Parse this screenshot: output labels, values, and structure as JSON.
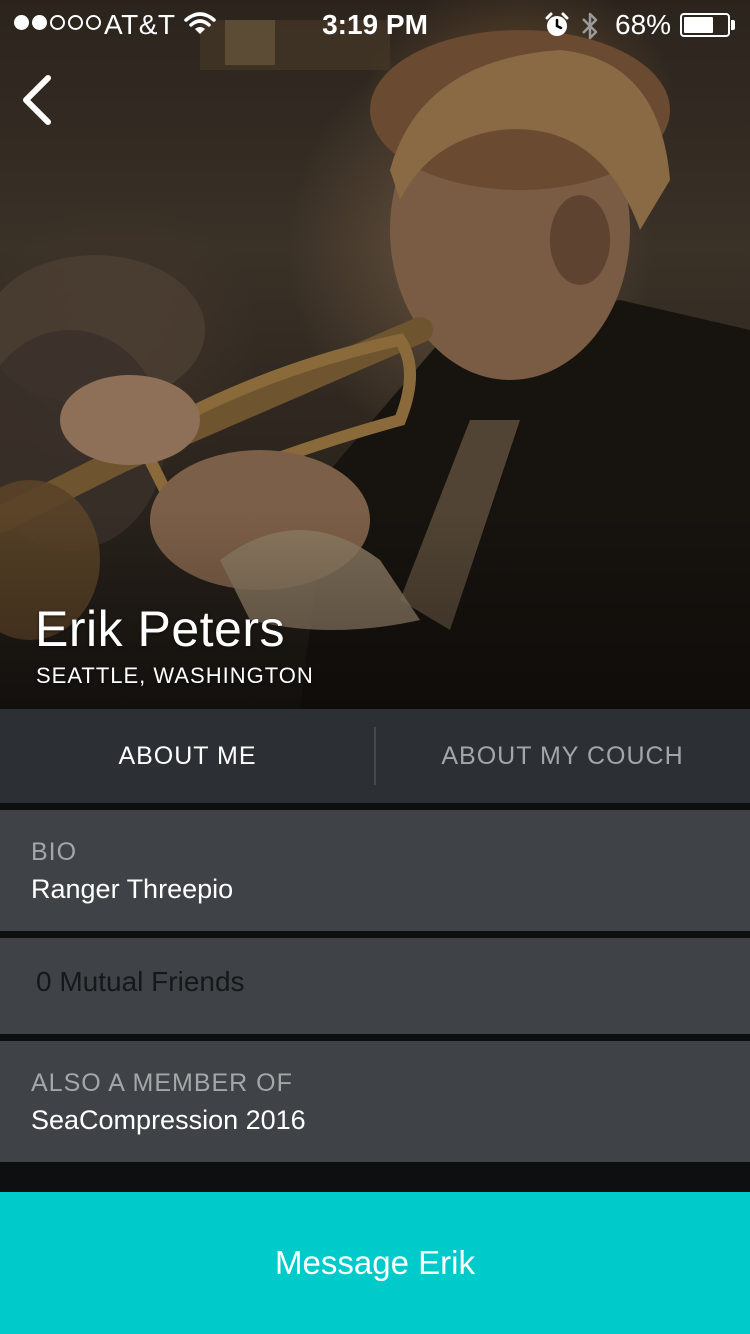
{
  "status_bar": {
    "carrier": "AT&T",
    "time": "3:19 PM",
    "battery_percent": "68%",
    "signal_bars_full": 2,
    "signal_bars_total": 5,
    "battery_level": 0.68
  },
  "navigation": {
    "back_icon": "chevron-left-icon"
  },
  "profile": {
    "name": "Erik Peters",
    "location": "SEATTLE, WASHINGTON"
  },
  "tabs": [
    {
      "label": "ABOUT ME",
      "active": true
    },
    {
      "label": "ABOUT MY COUCH",
      "active": false
    }
  ],
  "bio": {
    "label": "BIO",
    "value": "Ranger Threepio"
  },
  "mutual_friends": {
    "text": "0 Mutual Friends"
  },
  "membership": {
    "label": "ALSO A MEMBER OF",
    "value": "SeaCompression 2016"
  },
  "actions": {
    "message_label": "Message Erik"
  },
  "colors": {
    "accent": "#00cbca",
    "tab_bar": "#2c2f33",
    "card": "#3f4246",
    "muted_text": "#a4a7aa"
  }
}
